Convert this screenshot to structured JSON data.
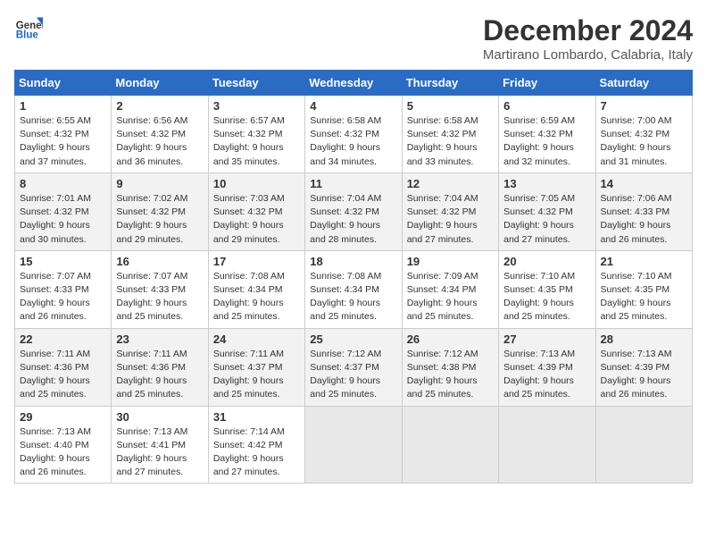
{
  "header": {
    "logo_line1": "General",
    "logo_line2": "Blue",
    "month_title": "December 2024",
    "location": "Martirano Lombardo, Calabria, Italy"
  },
  "weekdays": [
    "Sunday",
    "Monday",
    "Tuesday",
    "Wednesday",
    "Thursday",
    "Friday",
    "Saturday"
  ],
  "weeks": [
    [
      {
        "day": "1",
        "sunrise": "6:55 AM",
        "sunset": "4:32 PM",
        "daylight": "9 hours and 37 minutes."
      },
      {
        "day": "2",
        "sunrise": "6:56 AM",
        "sunset": "4:32 PM",
        "daylight": "9 hours and 36 minutes."
      },
      {
        "day": "3",
        "sunrise": "6:57 AM",
        "sunset": "4:32 PM",
        "daylight": "9 hours and 35 minutes."
      },
      {
        "day": "4",
        "sunrise": "6:58 AM",
        "sunset": "4:32 PM",
        "daylight": "9 hours and 34 minutes."
      },
      {
        "day": "5",
        "sunrise": "6:58 AM",
        "sunset": "4:32 PM",
        "daylight": "9 hours and 33 minutes."
      },
      {
        "day": "6",
        "sunrise": "6:59 AM",
        "sunset": "4:32 PM",
        "daylight": "9 hours and 32 minutes."
      },
      {
        "day": "7",
        "sunrise": "7:00 AM",
        "sunset": "4:32 PM",
        "daylight": "9 hours and 31 minutes."
      }
    ],
    [
      {
        "day": "8",
        "sunrise": "7:01 AM",
        "sunset": "4:32 PM",
        "daylight": "9 hours and 30 minutes."
      },
      {
        "day": "9",
        "sunrise": "7:02 AM",
        "sunset": "4:32 PM",
        "daylight": "9 hours and 29 minutes."
      },
      {
        "day": "10",
        "sunrise": "7:03 AM",
        "sunset": "4:32 PM",
        "daylight": "9 hours and 29 minutes."
      },
      {
        "day": "11",
        "sunrise": "7:04 AM",
        "sunset": "4:32 PM",
        "daylight": "9 hours and 28 minutes."
      },
      {
        "day": "12",
        "sunrise": "7:04 AM",
        "sunset": "4:32 PM",
        "daylight": "9 hours and 27 minutes."
      },
      {
        "day": "13",
        "sunrise": "7:05 AM",
        "sunset": "4:32 PM",
        "daylight": "9 hours and 27 minutes."
      },
      {
        "day": "14",
        "sunrise": "7:06 AM",
        "sunset": "4:33 PM",
        "daylight": "9 hours and 26 minutes."
      }
    ],
    [
      {
        "day": "15",
        "sunrise": "7:07 AM",
        "sunset": "4:33 PM",
        "daylight": "9 hours and 26 minutes."
      },
      {
        "day": "16",
        "sunrise": "7:07 AM",
        "sunset": "4:33 PM",
        "daylight": "9 hours and 25 minutes."
      },
      {
        "day": "17",
        "sunrise": "7:08 AM",
        "sunset": "4:34 PM",
        "daylight": "9 hours and 25 minutes."
      },
      {
        "day": "18",
        "sunrise": "7:08 AM",
        "sunset": "4:34 PM",
        "daylight": "9 hours and 25 minutes."
      },
      {
        "day": "19",
        "sunrise": "7:09 AM",
        "sunset": "4:34 PM",
        "daylight": "9 hours and 25 minutes."
      },
      {
        "day": "20",
        "sunrise": "7:10 AM",
        "sunset": "4:35 PM",
        "daylight": "9 hours and 25 minutes."
      },
      {
        "day": "21",
        "sunrise": "7:10 AM",
        "sunset": "4:35 PM",
        "daylight": "9 hours and 25 minutes."
      }
    ],
    [
      {
        "day": "22",
        "sunrise": "7:11 AM",
        "sunset": "4:36 PM",
        "daylight": "9 hours and 25 minutes."
      },
      {
        "day": "23",
        "sunrise": "7:11 AM",
        "sunset": "4:36 PM",
        "daylight": "9 hours and 25 minutes."
      },
      {
        "day": "24",
        "sunrise": "7:11 AM",
        "sunset": "4:37 PM",
        "daylight": "9 hours and 25 minutes."
      },
      {
        "day": "25",
        "sunrise": "7:12 AM",
        "sunset": "4:37 PM",
        "daylight": "9 hours and 25 minutes."
      },
      {
        "day": "26",
        "sunrise": "7:12 AM",
        "sunset": "4:38 PM",
        "daylight": "9 hours and 25 minutes."
      },
      {
        "day": "27",
        "sunrise": "7:13 AM",
        "sunset": "4:39 PM",
        "daylight": "9 hours and 25 minutes."
      },
      {
        "day": "28",
        "sunrise": "7:13 AM",
        "sunset": "4:39 PM",
        "daylight": "9 hours and 26 minutes."
      }
    ],
    [
      {
        "day": "29",
        "sunrise": "7:13 AM",
        "sunset": "4:40 PM",
        "daylight": "9 hours and 26 minutes."
      },
      {
        "day": "30",
        "sunrise": "7:13 AM",
        "sunset": "4:41 PM",
        "daylight": "9 hours and 27 minutes."
      },
      {
        "day": "31",
        "sunrise": "7:14 AM",
        "sunset": "4:42 PM",
        "daylight": "9 hours and 27 minutes."
      },
      null,
      null,
      null,
      null
    ]
  ],
  "labels": {
    "sunrise": "Sunrise:",
    "sunset": "Sunset:",
    "daylight": "Daylight:"
  }
}
